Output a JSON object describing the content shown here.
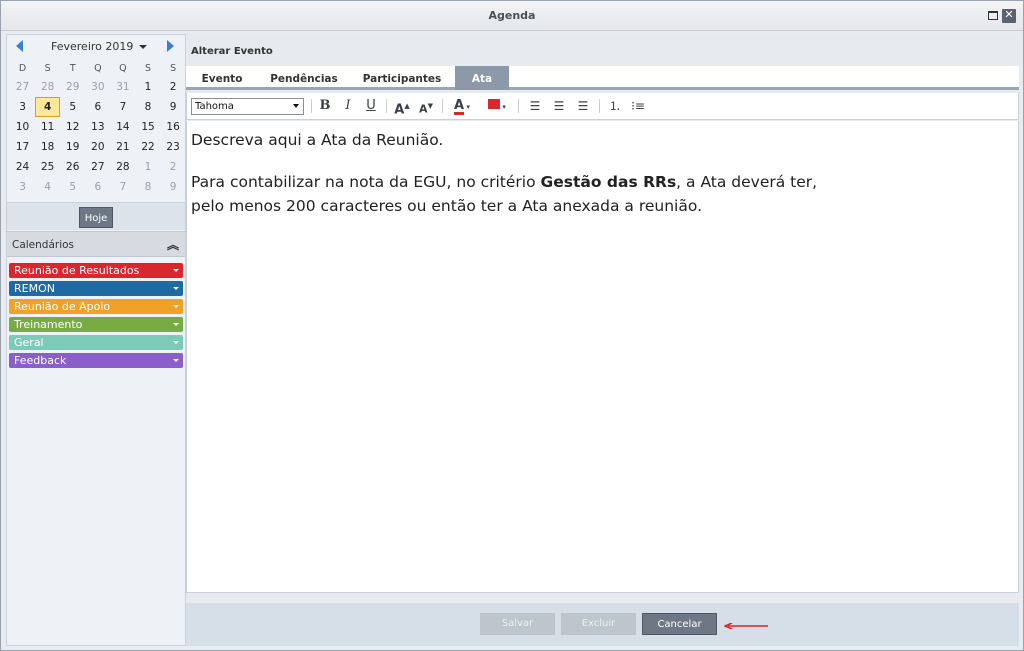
{
  "window": {
    "title": "Agenda"
  },
  "calendar": {
    "month_label": "Fevereiro 2019",
    "weekday_headers": [
      "D",
      "S",
      "T",
      "Q",
      "Q",
      "S",
      "S"
    ],
    "weeks": [
      [
        {
          "d": "27",
          "o": true
        },
        {
          "d": "28",
          "o": true
        },
        {
          "d": "29",
          "o": true
        },
        {
          "d": "30",
          "o": true
        },
        {
          "d": "31",
          "o": true
        },
        {
          "d": "1"
        },
        {
          "d": "2"
        }
      ],
      [
        {
          "d": "3"
        },
        {
          "d": "4",
          "today": true
        },
        {
          "d": "5"
        },
        {
          "d": "6"
        },
        {
          "d": "7"
        },
        {
          "d": "8"
        },
        {
          "d": "9"
        }
      ],
      [
        {
          "d": "10"
        },
        {
          "d": "11"
        },
        {
          "d": "12"
        },
        {
          "d": "13"
        },
        {
          "d": "14"
        },
        {
          "d": "15"
        },
        {
          "d": "16"
        }
      ],
      [
        {
          "d": "17"
        },
        {
          "d": "18"
        },
        {
          "d": "19"
        },
        {
          "d": "20"
        },
        {
          "d": "21"
        },
        {
          "d": "22"
        },
        {
          "d": "23"
        }
      ],
      [
        {
          "d": "24"
        },
        {
          "d": "25"
        },
        {
          "d": "26"
        },
        {
          "d": "27"
        },
        {
          "d": "28"
        },
        {
          "d": "1",
          "o": true
        },
        {
          "d": "2",
          "o": true
        }
      ],
      [
        {
          "d": "3",
          "o": true
        },
        {
          "d": "4",
          "o": true
        },
        {
          "d": "5",
          "o": true
        },
        {
          "d": "6",
          "o": true
        },
        {
          "d": "7",
          "o": true
        },
        {
          "d": "8",
          "o": true
        },
        {
          "d": "9",
          "o": true
        }
      ]
    ],
    "today_button": "Hoje"
  },
  "calendars": {
    "label": "Calendários",
    "items": [
      {
        "label": "Reunião de Resultados",
        "color": "#d9272e"
      },
      {
        "label": "REMON",
        "color": "#1e6aa3"
      },
      {
        "label": "Reunião de Apoio",
        "color": "#f0a12a"
      },
      {
        "label": "Treinamento",
        "color": "#77ab43"
      },
      {
        "label": "Geral",
        "color": "#7ccbb8"
      },
      {
        "label": "Feedback",
        "color": "#8b5fcb"
      }
    ]
  },
  "event": {
    "title": "Alterar Evento",
    "tabs": [
      "Evento",
      "Pendências",
      "Participantes",
      "Ata"
    ],
    "active_tab": "Ata"
  },
  "toolbar": {
    "font": "Tahoma",
    "icons": [
      "bold-icon",
      "italic-icon",
      "underline-icon",
      "increase-font-icon",
      "decrease-font-icon",
      "font-color-icon",
      "highlight-color-icon",
      "align-left-icon",
      "align-center-icon",
      "align-right-icon",
      "numbered-list-icon",
      "bullet-list-icon"
    ]
  },
  "editor": {
    "line1": "Descreva aqui a Ata da Reunião.",
    "line2_pre": "Para contabilizar na nota da EGU, no critério ",
    "line2_bold": "Gestão das RRs",
    "line2_post": ", a Ata deverá ter,",
    "line3": "pelo menos 200 caracteres ou então ter a Ata anexada a reunião."
  },
  "footer": {
    "save": "Salvar",
    "delete": "Excluir",
    "cancel": "Cancelar"
  },
  "colors": {
    "annotation_arrow": "#e02020"
  }
}
